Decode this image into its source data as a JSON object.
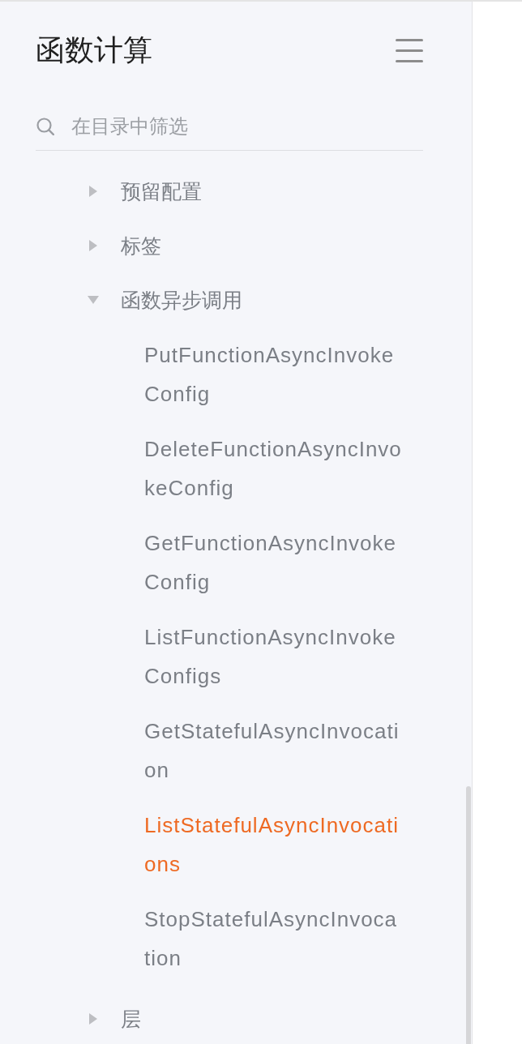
{
  "header": {
    "title": "函数计算"
  },
  "search": {
    "placeholder": "在目录中筛选"
  },
  "tree": [
    {
      "label": "预留配置",
      "expanded": false,
      "selected": false
    },
    {
      "label": "标签",
      "expanded": false,
      "selected": false
    },
    {
      "label": "函数异步调用",
      "expanded": true,
      "selected": false,
      "children": [
        {
          "label": "PutFunctionAsyncInvokeConfig",
          "selected": false
        },
        {
          "label": "DeleteFunctionAsyncInvokeConfig",
          "selected": false
        },
        {
          "label": "GetFunctionAsyncInvokeConfig",
          "selected": false
        },
        {
          "label": "ListFunctionAsyncInvokeConfigs",
          "selected": false
        },
        {
          "label": "GetStatefulAsyncInvocation",
          "selected": false
        },
        {
          "label": "ListStatefulAsyncInvocations",
          "selected": true
        },
        {
          "label": "StopStatefulAsyncInvocation",
          "selected": false
        }
      ]
    },
    {
      "label": "层",
      "expanded": false,
      "selected": false
    }
  ]
}
